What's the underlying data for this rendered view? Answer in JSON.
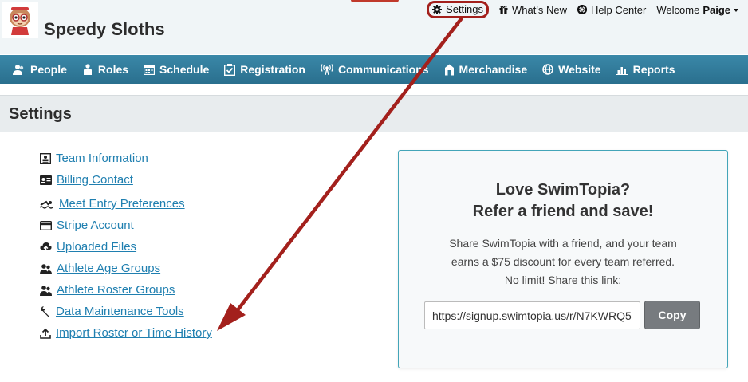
{
  "header": {
    "team_name": "Speedy Sloths",
    "topnav": {
      "settings": "Settings",
      "whats_new": "What's New",
      "help_center": "Help Center",
      "welcome_prefix": "Welcome",
      "user_name": "Paige"
    }
  },
  "mainnav": {
    "items": [
      {
        "label": "People",
        "icon": "people-icon"
      },
      {
        "label": "Roles",
        "icon": "roles-icon"
      },
      {
        "label": "Schedule",
        "icon": "calendar-icon"
      },
      {
        "label": "Registration",
        "icon": "clipboard-check-icon"
      },
      {
        "label": "Communications",
        "icon": "broadcast-icon"
      },
      {
        "label": "Merchandise",
        "icon": "store-icon"
      },
      {
        "label": "Website",
        "icon": "globe-icon"
      },
      {
        "label": "Reports",
        "icon": "bar-chart-icon"
      }
    ]
  },
  "settings": {
    "title": "Settings",
    "links": [
      {
        "label": "Team Information",
        "icon": "id-card-icon"
      },
      {
        "label": "Billing Contact",
        "icon": "contact-card-icon"
      },
      {
        "label": "Meet Entry Preferences",
        "icon": "swimmer-icon"
      },
      {
        "label": "Stripe Account",
        "icon": "credit-card-icon"
      },
      {
        "label": "Uploaded Files",
        "icon": "cloud-upload-icon"
      },
      {
        "label": "Athlete Age Groups",
        "icon": "users-icon"
      },
      {
        "label": "Athlete Roster Groups",
        "icon": "users-icon"
      },
      {
        "label": "Data Maintenance Tools",
        "icon": "wrench-icon"
      },
      {
        "label": "Import Roster or Time History",
        "icon": "upload-icon"
      }
    ]
  },
  "referral": {
    "title_line1": "Love SwimTopia?",
    "title_line2": "Refer a friend and save!",
    "body_line1": "Share SwimTopia with a friend, and your team",
    "body_line2": "earns a $75 discount for every team referred.",
    "body_line3": "No limit! Share this link:",
    "link_value": "https://signup.swimtopia.us/r/N7KWRQ5",
    "copy_label": "Copy"
  },
  "colors": {
    "nav_bar": "#2f7b9b",
    "link": "#1f7fb0",
    "annotation": "#a3201c",
    "card_border": "#43a5b8"
  }
}
